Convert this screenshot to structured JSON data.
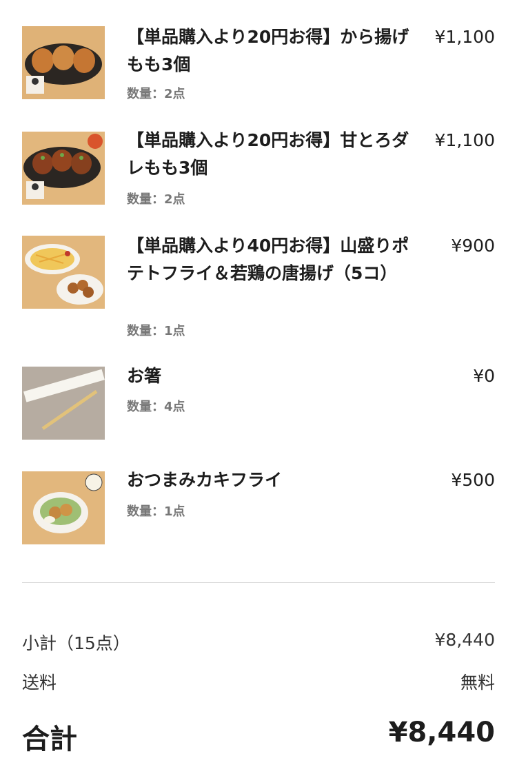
{
  "items": [
    {
      "title": "【単品購入より20円お得】から揚げもも3個",
      "price": "¥1,100",
      "qty": "数量：2点"
    },
    {
      "title": "【単品購入より20円お得】甘とろダレもも3個",
      "price": "¥1,100",
      "qty": "数量：2点"
    },
    {
      "title": "【単品購入より40円お得】山盛りポテトフライ＆若鶏の唐揚げ（5コ）",
      "price": "¥900",
      "qty": "数量：1点"
    },
    {
      "title": "お箸",
      "price": "¥0",
      "qty": "数量：4点"
    },
    {
      "title": "おつまみカキフライ",
      "price": "¥500",
      "qty": "数量：1点"
    }
  ],
  "summary": {
    "subtotal_label": "小計（15点）",
    "subtotal_value": "¥8,440",
    "shipping_label": "送料",
    "shipping_value": "無料",
    "total_label": "合計",
    "total_value": "¥8,440"
  }
}
